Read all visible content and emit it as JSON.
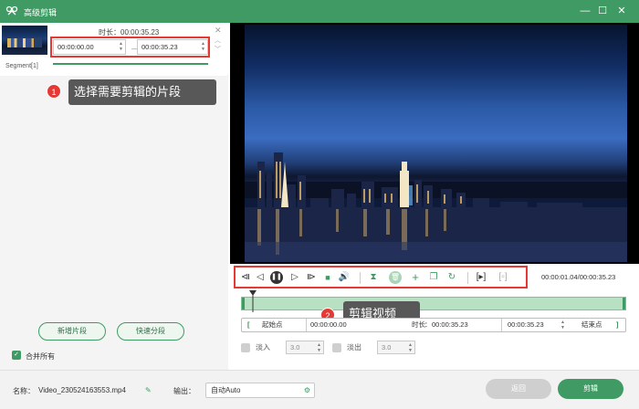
{
  "window": {
    "title": "高级剪辑",
    "controls": [
      "minimize-icon",
      "maximize-icon",
      "close-icon"
    ]
  },
  "segment_panel": {
    "duration_label": "时长：00:00:35.23",
    "segment_label": "Segment[1]",
    "start_time": "00:00:00.00",
    "end_time": "00:00:35.23",
    "separator": "—"
  },
  "left_actions": {
    "add_segment": "新增片段",
    "quick_split": "快速分段",
    "merge_all": "合并所有",
    "merge_all_checked": true
  },
  "callouts": {
    "one_number": "1",
    "one_text": "选择需要剪辑的片段",
    "two_number": "2",
    "two_text": "剪辑视频"
  },
  "player": {
    "timecode": "00:00:01.04/00:00:35.23",
    "playhead_fraction": 0.03
  },
  "range": {
    "start_point_label": "起始点",
    "start_value": "00:00:00.00",
    "duration_label": "时长",
    "duration_value": "00:00:35.23",
    "end_value": "00:00:35.23",
    "end_point_label": "结束点"
  },
  "fade": {
    "fade_in_label": "淡入",
    "fade_in_value": "3.0",
    "fade_out_label": "淡出",
    "fade_out_value": "3.0"
  },
  "bottom": {
    "name_label": "名称：",
    "file_name": "Video_230524163553.mp4",
    "output_label": "输出：",
    "output_value": "自动Auto",
    "back_button": "返回",
    "cut_button": "剪辑"
  },
  "colors": {
    "accent": "#3f9b63",
    "highlight_red": "#e53935"
  }
}
